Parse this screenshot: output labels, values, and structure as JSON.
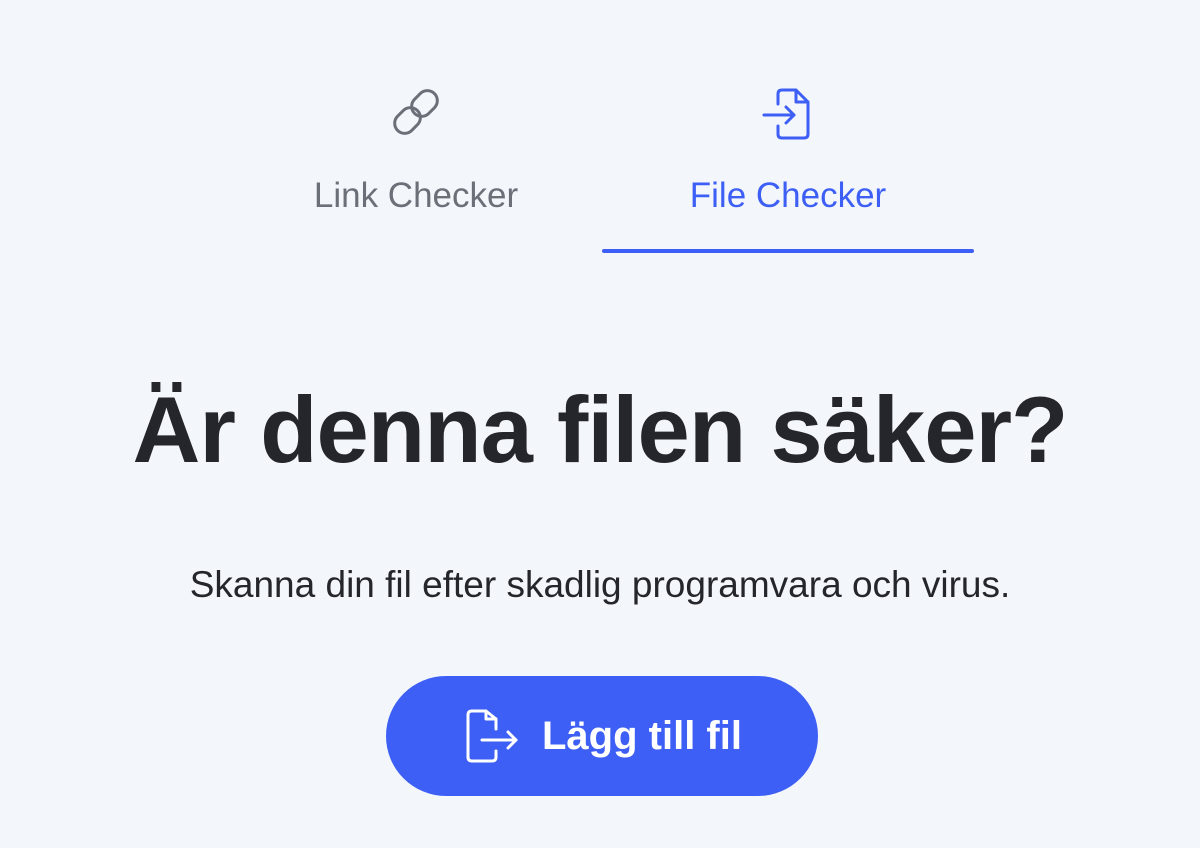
{
  "tabs": [
    {
      "label": "Link Checker",
      "icon": "link-icon",
      "active": false
    },
    {
      "label": "File Checker",
      "icon": "file-import-icon",
      "active": true
    }
  ],
  "hero": {
    "title": "Är denna filen säker?",
    "subtitle": "Skanna din fil efter skadlig programvara och virus."
  },
  "upload_button": {
    "label": "Lägg till fil",
    "icon": "file-upload-icon"
  },
  "colors": {
    "background": "#f3f6fb",
    "accent": "#3d5ff5",
    "text": "#25262b",
    "muted": "#6b6f78"
  }
}
